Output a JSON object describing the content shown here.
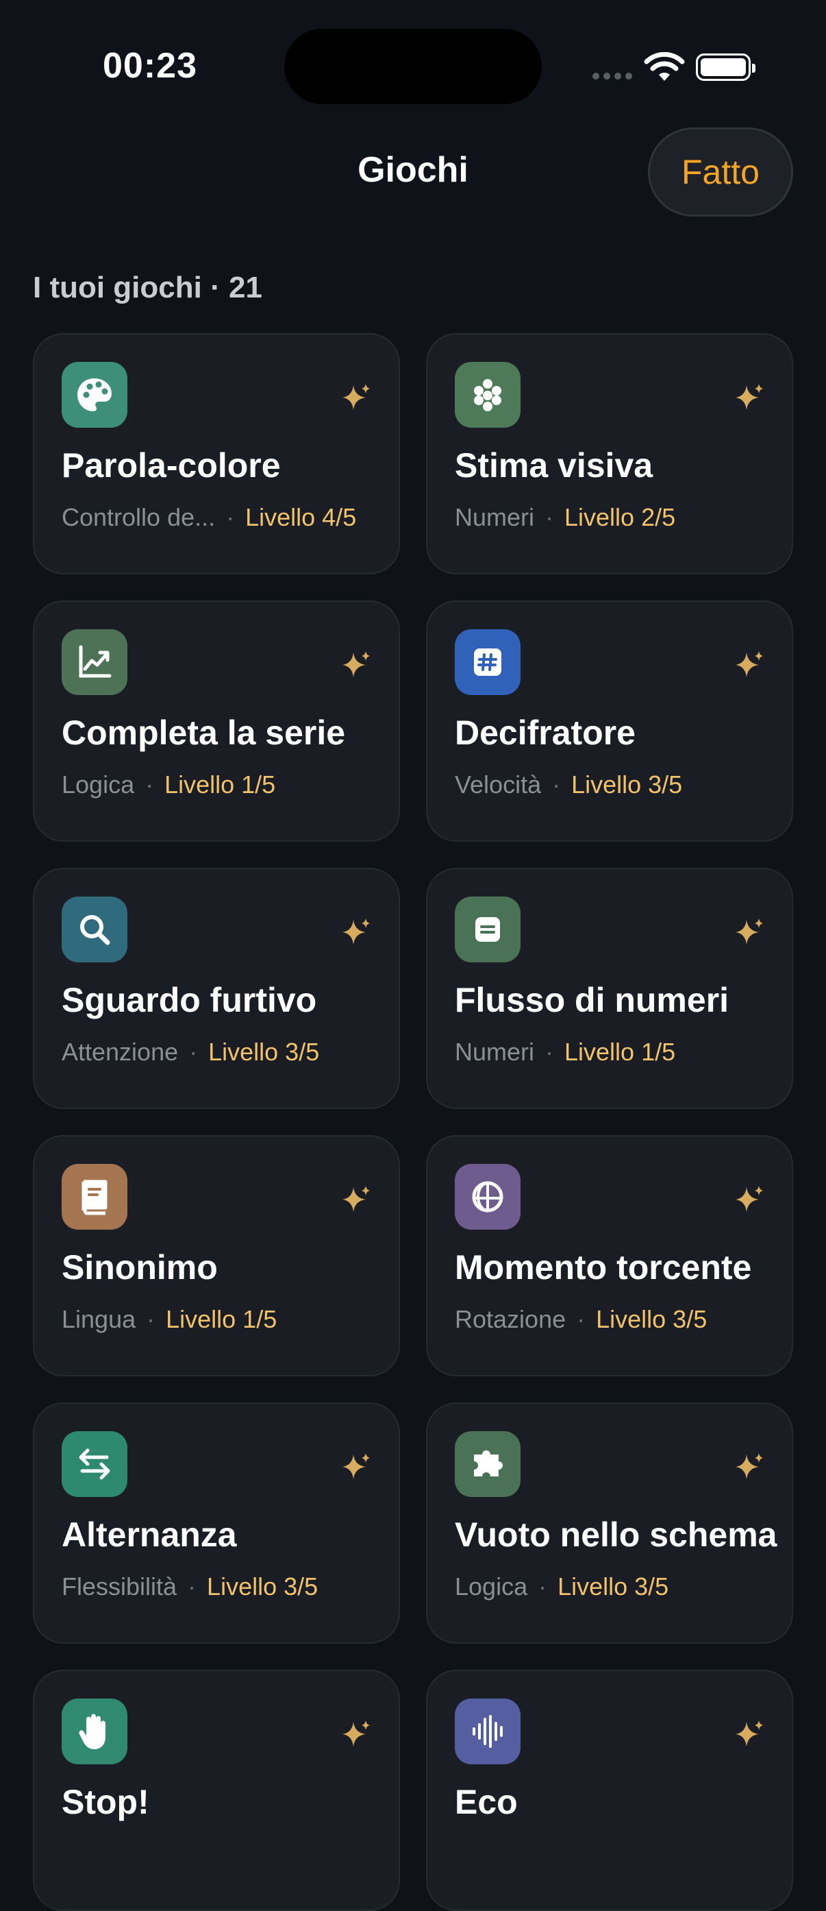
{
  "status": {
    "time": "00:23"
  },
  "nav": {
    "title": "Giochi",
    "done_label": "Fatto"
  },
  "section": {
    "header": "I tuoi giochi · 21"
  },
  "games": [
    {
      "title": "Parola-colore",
      "category": "Controllo de...",
      "level": "Livello 4/5",
      "icon": "palette-icon",
      "color": "#3d8f7a"
    },
    {
      "title": "Stima visiva",
      "category": "Numeri",
      "level": "Livello 2/5",
      "icon": "dots-cluster-icon",
      "color": "#4f7a5a"
    },
    {
      "title": "Completa la serie",
      "category": "Logica",
      "level": "Livello 1/5",
      "icon": "chart-trend-icon",
      "color": "#4d7256"
    },
    {
      "title": "Decifratore",
      "category": "Velocità",
      "level": "Livello 3/5",
      "icon": "hashtag-icon",
      "color": "#2f62b8"
    },
    {
      "title": "Sguardo furtivo",
      "category": "Attenzione",
      "level": "Livello 3/5",
      "icon": "magnifier-icon",
      "color": "#2f6b7d"
    },
    {
      "title": "Flusso di numeri",
      "category": "Numeri",
      "level": "Livello 1/5",
      "icon": "note-icon",
      "color": "#4a7256"
    },
    {
      "title": "Sinonimo",
      "category": "Lingua",
      "level": "Livello 1/5",
      "icon": "book-icon",
      "color": "#a47550"
    },
    {
      "title": "Momento torcente",
      "category": "Rotazione",
      "level": "Livello 3/5",
      "icon": "globe-icon",
      "color": "#6f5c8f"
    },
    {
      "title": "Alternanza",
      "category": "Flessibilità",
      "level": "Livello 3/5",
      "icon": "swap-arrows-icon",
      "color": "#2e8a6f"
    },
    {
      "title": "Vuoto nello schema",
      "category": "Logica",
      "level": "Livello 3/5",
      "icon": "puzzle-icon",
      "color": "#4a7256"
    },
    {
      "title": "Stop!",
      "category": "",
      "level": "",
      "icon": "hand-icon",
      "color": "#2f8a6f"
    },
    {
      "title": "Eco",
      "category": "",
      "level": "",
      "icon": "waveform-icon",
      "color": "#545ea0"
    }
  ]
}
